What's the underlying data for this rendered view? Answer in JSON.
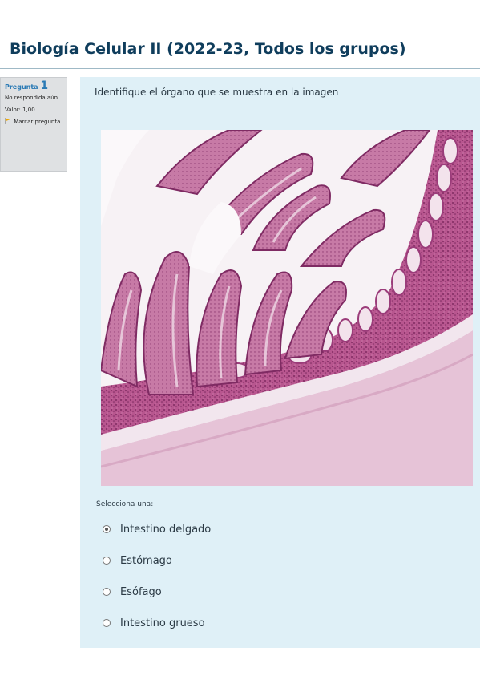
{
  "course": {
    "title": "Biología Celular II (2022-23, Todos los grupos)"
  },
  "question_info": {
    "label": "Pregunta",
    "number": "1",
    "state": "No respondida aún",
    "grade": "Valor: 1,00",
    "flag_label": "Marcar pregunta"
  },
  "question": {
    "text": "Identifique el órgano que se muestra en la imagen",
    "prompt": "Selecciona una:",
    "options": [
      {
        "label": "Intestino delgado",
        "selected": true
      },
      {
        "label": "Estómago",
        "selected": false
      },
      {
        "label": "Esófago",
        "selected": false
      },
      {
        "label": "Intestino grueso",
        "selected": false
      }
    ]
  },
  "colors": {
    "title": "#0f3d5c",
    "accent": "#2a7ab5",
    "content_bg": "#dff0f7",
    "info_bg": "#dfe1e3",
    "tissue_dark": "#8a2f6c",
    "tissue_light": "#e9c9dc"
  }
}
